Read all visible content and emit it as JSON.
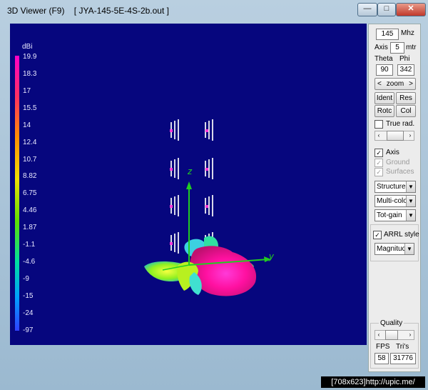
{
  "window": {
    "title": "3D Viewer (F9)    [ JYA-145-5E-4S-2b.out ]",
    "minimize_glyph": "—",
    "maximize_glyph": "□",
    "close_glyph": "✕"
  },
  "legend": {
    "unit": "dBi",
    "ticks": [
      "19.9",
      "18.3",
      "17",
      "15.5",
      "14",
      "12.4",
      "10.7",
      "8.82",
      "6.75",
      "4.46",
      "1.87",
      "-1.1",
      "-4.6",
      "-9",
      "-15",
      "-24",
      "-97"
    ]
  },
  "axes": {
    "z_label": "z",
    "y_label": "y"
  },
  "panel": {
    "frequency_value": "145",
    "frequency_unit": "Mhz",
    "axis_label": "Axis",
    "axis_value": "5",
    "axis_unit": "mtr",
    "theta_label": "Theta",
    "phi_label": "Phi",
    "theta_value": "90",
    "phi_value": "342",
    "zoom_left": "<",
    "zoom_label": "zoom",
    "zoom_right": ">",
    "ident_label": "Ident",
    "res_label": "Res",
    "rotc_label": "Rotc",
    "col_label": "Col",
    "true_rad_label": "True rad.",
    "true_rad_checked": false,
    "axis_check_label": "Axis",
    "axis_checked": true,
    "ground_label": "Ground",
    "surfaces_label": "Surfaces",
    "structure_select": "Structure",
    "color_select": "Multi-colo",
    "gain_select": "Tot-gain",
    "arrl_label": "ARRL style",
    "arrl_checked": true,
    "magnitude_select": "Magnitud",
    "quality_label": "Quality",
    "fps_label": "FPS",
    "tris_label": "Tri's",
    "fps_value": "58",
    "tris_value": "31776",
    "check_mark": "✓",
    "dropdown_glyph": "▼",
    "slider_left": "‹",
    "slider_right": "›"
  },
  "footer": {
    "text": "[708x623]http://upic.me/"
  },
  "colors": {
    "background": "#06067e",
    "accent_magenta": "#ff2aa8",
    "axis_green": "#22cc22"
  }
}
